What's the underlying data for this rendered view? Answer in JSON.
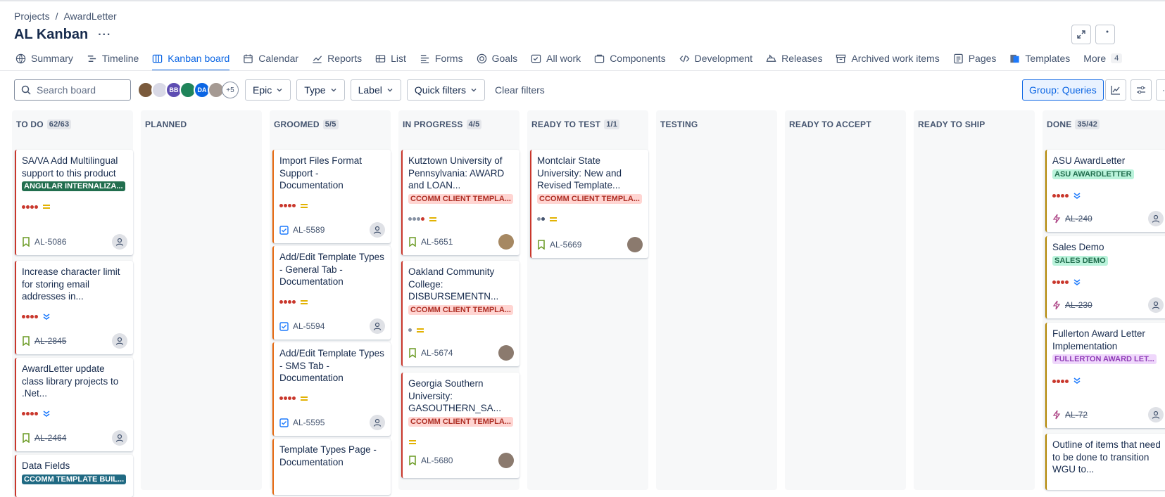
{
  "breadcrumb": {
    "projects": "Projects",
    "separator": "/",
    "project": "AwardLetter"
  },
  "page": {
    "title": "AL Kanban",
    "more": "···"
  },
  "tabs": [
    {
      "label": "Summary",
      "icon": "globe-icon"
    },
    {
      "label": "Timeline",
      "icon": "timeline-icon"
    },
    {
      "label": "Kanban board",
      "icon": "board-icon",
      "active": true
    },
    {
      "label": "Calendar",
      "icon": "calendar-icon"
    },
    {
      "label": "Reports",
      "icon": "chart-icon"
    },
    {
      "label": "List",
      "icon": "list-icon"
    },
    {
      "label": "Forms",
      "icon": "forms-icon"
    },
    {
      "label": "Goals",
      "icon": "target-icon"
    },
    {
      "label": "All work",
      "icon": "checklist-icon"
    },
    {
      "label": "Components",
      "icon": "components-icon"
    },
    {
      "label": "Development",
      "icon": "code-icon"
    },
    {
      "label": "Releases",
      "icon": "ship-icon"
    },
    {
      "label": "Archived work items",
      "icon": "archive-icon"
    },
    {
      "label": "Pages",
      "icon": "page-icon"
    },
    {
      "label": "Templates",
      "icon": "templates-icon"
    }
  ],
  "tab_more": {
    "label": "More",
    "count": "4"
  },
  "toolbar": {
    "search_placeholder": "Search board",
    "avatars": [
      "",
      "",
      "BB",
      "",
      "DA",
      ""
    ],
    "avatar_overflow": "+5",
    "filters": [
      "Epic",
      "Type",
      "Label",
      "Quick filters"
    ],
    "clear": "Clear filters",
    "group": "Group: Queries"
  },
  "columns": [
    {
      "name": "TO DO",
      "count": "62/63"
    },
    {
      "name": "PLANNED",
      "count": ""
    },
    {
      "name": "GROOMED",
      "count": "5/5"
    },
    {
      "name": "IN PROGRESS",
      "count": "4/5"
    },
    {
      "name": "READY TO TEST",
      "count": "1/1"
    },
    {
      "name": "TESTING",
      "count": ""
    },
    {
      "name": "READY TO ACCEPT",
      "count": ""
    },
    {
      "name": "READY TO SHIP",
      "count": ""
    },
    {
      "name": "DONE",
      "count": "35/42"
    }
  ],
  "cards": {
    "todo": [
      {
        "title": "SA/VA Add Multilingual support to this product",
        "label": "ANGULAR INTERNALIZA...",
        "key": "AL-5086"
      },
      {
        "title": "Increase character limit for storing email addresses in...",
        "key": "AL-2845"
      },
      {
        "title": "AwardLetter update class library projects to .Net...",
        "key": "AL-2464"
      },
      {
        "title": "Data Fields",
        "label": "CCOMM TEMPLATE BUIL..."
      }
    ],
    "groomed": [
      {
        "title": "Import Files Format Support - Documentation",
        "key": "AL-5589"
      },
      {
        "title": "Add/Edit Template Types - General Tab - Documentation",
        "key": "AL-5594"
      },
      {
        "title": "Add/Edit Template Types - SMS Tab - Documentation",
        "key": "AL-5595"
      },
      {
        "title": "Template Types Page - Documentation"
      }
    ],
    "inprogress": [
      {
        "title": "Kutztown University of Pennsylvania: AWARD and LOAN...",
        "label": "CCOMM CLIENT TEMPLA...",
        "key": "AL-5651"
      },
      {
        "title": "Oakland Community College: DISBURSEMENTN...",
        "label": "CCOMM CLIENT TEMPLA...",
        "key": "AL-5674"
      },
      {
        "title": "Georgia Southern University: GASOUTHERN_SA...",
        "label": "CCOMM CLIENT TEMPLA...",
        "key": "AL-5680"
      }
    ],
    "readytotest": [
      {
        "title": "Montclair State University: New and Revised Template...",
        "label": "CCOMM CLIENT TEMPLA...",
        "key": "AL-5669"
      }
    ],
    "done": [
      {
        "title": "ASU AwardLetter",
        "label": "ASU AWARDLETTER",
        "key": "AL-240"
      },
      {
        "title": "Sales Demo",
        "label": "SALES DEMO",
        "key": "AL-230"
      },
      {
        "title": "Fullerton Award Letter Implementation",
        "label": "FULLERTON AWARD LET...",
        "key": "AL-72"
      },
      {
        "title": "Outline of items that need to be done to transition WGU to..."
      }
    ]
  },
  "colors": {
    "accent": "#0c66e4",
    "story": "#6a9a23",
    "task": "#1d7afc",
    "epic": "#ae4787"
  }
}
